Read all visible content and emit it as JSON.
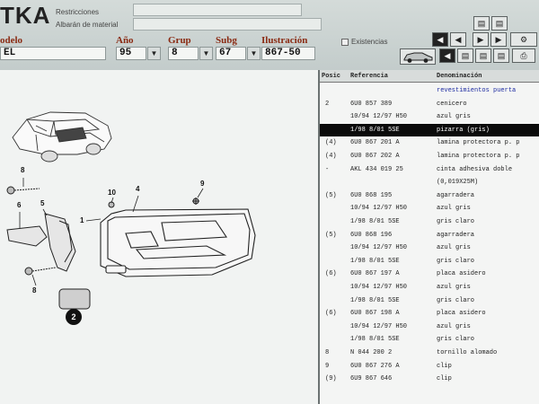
{
  "app": {
    "brand": "TKA"
  },
  "header": {
    "restricciones_label": "Restricciones",
    "albaran_label": "Albarán de material",
    "existencias_label": "Existencias",
    "fields": {
      "modelo": {
        "label": "odelo",
        "value": "EL"
      },
      "anio": {
        "label": "Año",
        "value": "95"
      },
      "grup": {
        "label": "Grup",
        "value": "8"
      },
      "subg": {
        "label": "Subg",
        "value": "67"
      },
      "ilustracion": {
        "label": "Ilustración",
        "value": "867-50"
      }
    }
  },
  "diagram": {
    "callouts": [
      "8",
      "6",
      "5",
      "1",
      "10",
      "4",
      "9",
      "8",
      "2"
    ]
  },
  "table": {
    "columns": {
      "pos": "Posic",
      "ref": "Referencia",
      "den": "Denominación"
    },
    "rows": [
      {
        "pos": "",
        "ref": "",
        "den": "revestimientos puerta",
        "sel": false,
        "head": true
      },
      {
        "pos": "2",
        "ref": "6U0 857 389",
        "den": "cenicero",
        "sel": false
      },
      {
        "pos": "",
        "ref": "10/94 12/97 H50",
        "den": "azul gris",
        "sel": false
      },
      {
        "pos": "",
        "ref": "1/98   8/01 5SE",
        "den": "pizarra (gris)",
        "sel": true
      },
      {
        "pos": "(4)",
        "ref": "6U0 867 201 A",
        "den": "lamina protectora p. p",
        "sel": false
      },
      {
        "pos": "(4)",
        "ref": "6U0 867 202 A",
        "den": "lamina protectora p. p",
        "sel": false
      },
      {
        "pos": "-",
        "ref": "AKL 434 019 25",
        "den": "cinta adhesiva doble",
        "sel": false
      },
      {
        "pos": "",
        "ref": "",
        "den": "(0,019X25M)",
        "sel": false
      },
      {
        "pos": "(5)",
        "ref": "6U0 868 195",
        "den": "agarradera",
        "sel": false
      },
      {
        "pos": "",
        "ref": "10/94 12/97 H50",
        "den": "azul gris",
        "sel": false
      },
      {
        "pos": "",
        "ref": "1/98   8/01 5SE",
        "den": "gris claro",
        "sel": false
      },
      {
        "pos": "(5)",
        "ref": "6U0 868 196",
        "den": "agarradera",
        "sel": false
      },
      {
        "pos": "",
        "ref": "10/94 12/97 H50",
        "den": "azul gris",
        "sel": false
      },
      {
        "pos": "",
        "ref": "1/98   8/01 5SE",
        "den": "gris claro",
        "sel": false
      },
      {
        "pos": "(6)",
        "ref": "6U0 867 197 A",
        "den": "placa asidero",
        "sel": false
      },
      {
        "pos": "",
        "ref": "10/94 12/97 H50",
        "den": "azul gris",
        "sel": false
      },
      {
        "pos": "",
        "ref": "1/98   8/01 5SE",
        "den": "gris claro",
        "sel": false
      },
      {
        "pos": "(6)",
        "ref": "6U0 867 198 A",
        "den": "placa asidero",
        "sel": false
      },
      {
        "pos": "",
        "ref": "10/94 12/97 H50",
        "den": "azul gris",
        "sel": false
      },
      {
        "pos": "",
        "ref": "1/98   8/01 5SE",
        "den": "gris claro",
        "sel": false
      },
      {
        "pos": "8",
        "ref": "N   044 200 2",
        "den": "tornillo alomado",
        "sel": false
      },
      {
        "pos": "9",
        "ref": "6U0 867 276 A",
        "den": "clip",
        "sel": false
      },
      {
        "pos": "(9)",
        "ref": "6U9 867 646",
        "den": "clip",
        "sel": false
      }
    ]
  },
  "colors": {
    "field_label": "#8a2a12",
    "selected_row": "#0b0b0b",
    "group_heading": "#1c2aa0"
  },
  "icons": [
    "car-icon",
    "printer-icon",
    "nav-first-icon",
    "nav-prev-icon",
    "nav-next-icon",
    "nav-last-icon",
    "page-icon"
  ]
}
